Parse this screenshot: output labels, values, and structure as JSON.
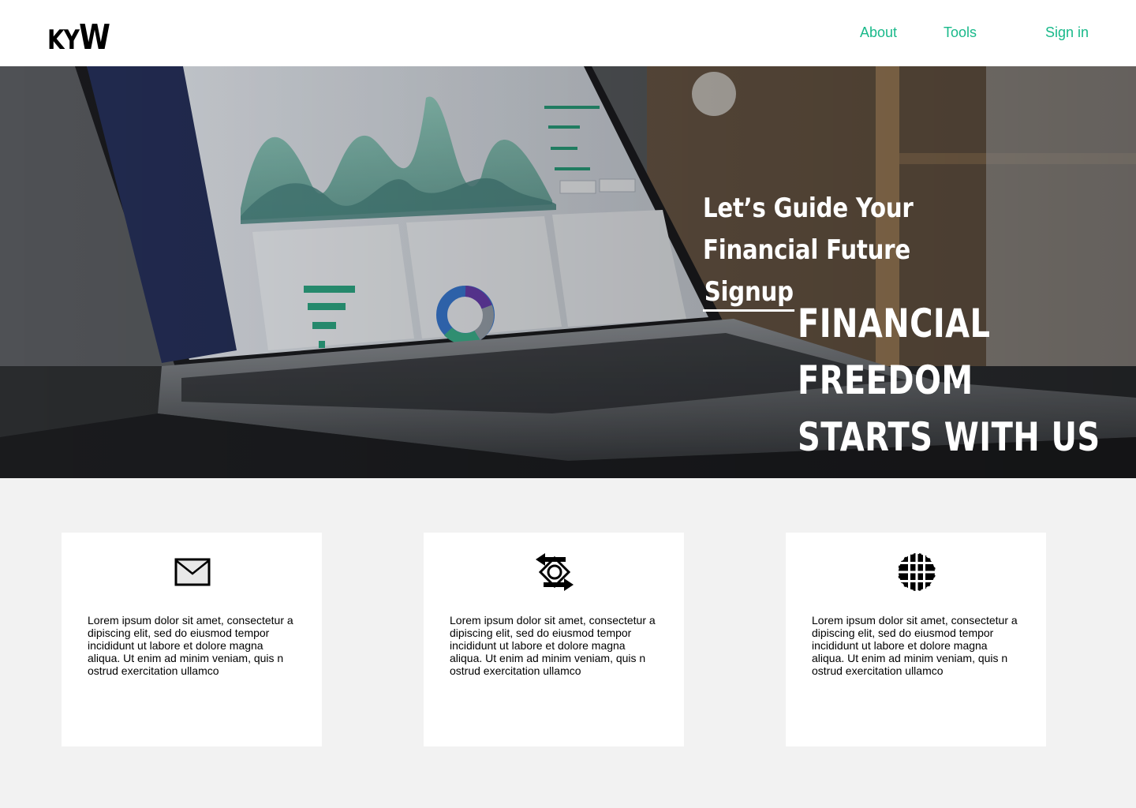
{
  "header": {
    "logo": {
      "part1": "K",
      "part2": "Y",
      "part3": "W"
    },
    "nav": [
      {
        "label": "About"
      },
      {
        "label": "Tools"
      },
      {
        "label": "Sign in"
      }
    ],
    "accent_color": "#19b98a"
  },
  "hero": {
    "tagline_text": "Let’s Guide Your Financial Future",
    "signup_label": "Signup",
    "headline_line1": "FINANCIAL FREEDOM",
    "headline_line2": "STARTS WITH US"
  },
  "cards": [
    {
      "icon": "envelope-icon",
      "text": "Lorem ipsum dolor sit amet, consectetur a\ndipiscing elit, sed do eiusmod tempor\n incididunt ut labore et dolore magna\naliqua. Ut enim ad minim veniam, quis n\nostrud exercitation ullamco"
    },
    {
      "icon": "exchange-icon",
      "text": "Lorem ipsum dolor sit amet, consectetur a\ndipiscing elit, sed do eiusmod tempor\n incididunt ut labore et dolore magna\naliqua. Ut enim ad minim veniam, quis n\nostrud exercitation ullamco"
    },
    {
      "icon": "globe-icon",
      "text": "Lorem ipsum dolor sit amet, consectetur a\ndipiscing elit, sed do eiusmod tempor\n incididunt ut labore et dolore magna\naliqua. Ut enim ad minim veniam, quis n\nostrud exercitation ullamco"
    }
  ]
}
